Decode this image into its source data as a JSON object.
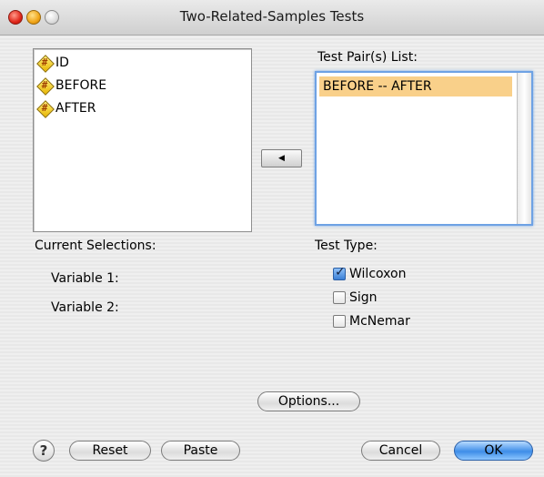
{
  "window": {
    "title": "Two-Related-Samples Tests"
  },
  "variables": [
    {
      "name": "ID",
      "icon": "scale-variable-icon"
    },
    {
      "name": "BEFORE",
      "icon": "scale-variable-icon"
    },
    {
      "name": "AFTER",
      "icon": "scale-variable-icon"
    }
  ],
  "pairs": {
    "label": "Test Pair(s) List:",
    "items": [
      "BEFORE -- AFTER"
    ]
  },
  "move_button": {
    "glyph": "◀"
  },
  "current_selections": {
    "label": "Current Selections:",
    "var1_label": "Variable 1:",
    "var2_label": "Variable 2:"
  },
  "test_type": {
    "label": "Test Type:",
    "options": [
      {
        "label": "Wilcoxon",
        "checked": true
      },
      {
        "label": "Sign",
        "checked": false
      },
      {
        "label": "McNemar",
        "checked": false
      }
    ]
  },
  "buttons": {
    "help": "?",
    "options": "Options...",
    "reset": "Reset",
    "paste": "Paste",
    "cancel": "Cancel",
    "ok": "OK"
  },
  "colors": {
    "selection": "#f9d08a",
    "focus": "#6ea2e4",
    "default_button": "#3e8de8"
  }
}
